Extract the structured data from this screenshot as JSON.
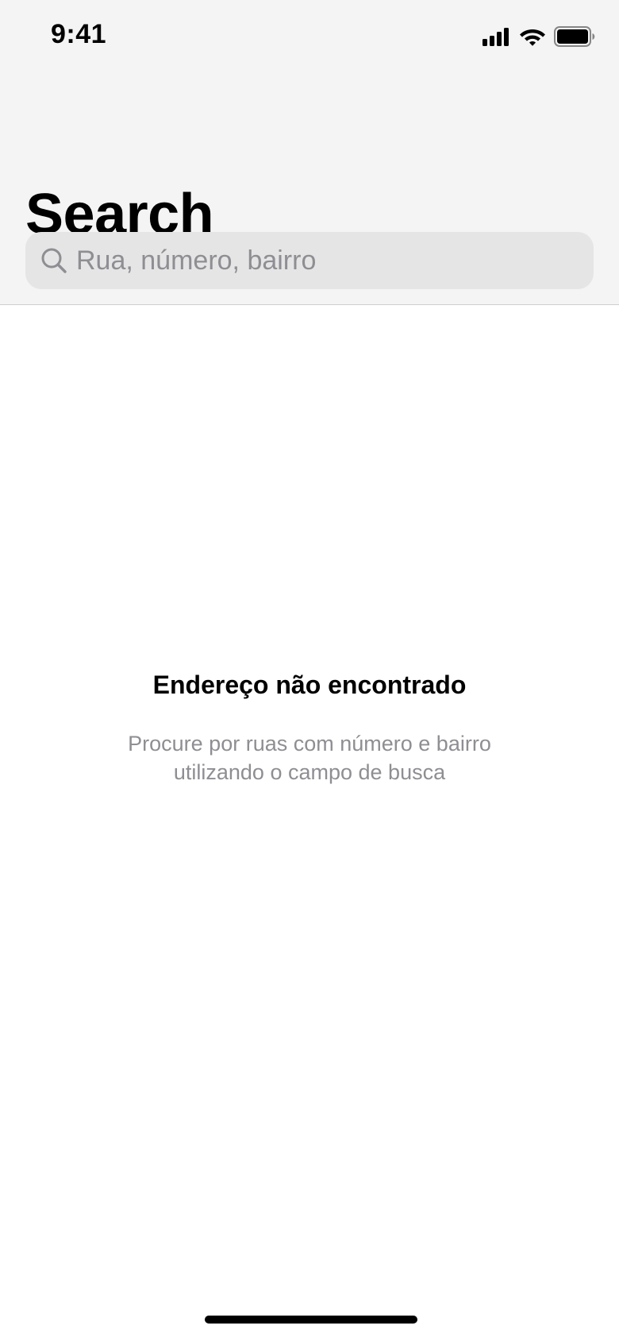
{
  "status_bar": {
    "time": "9:41",
    "icons": [
      "cellular-signal-icon",
      "wifi-icon",
      "battery-icon"
    ]
  },
  "header": {
    "title": "Search"
  },
  "search": {
    "icon": "search-icon",
    "placeholder": "Rua, número, bairro",
    "value": ""
  },
  "empty_state": {
    "title": "Endereço não encontrado",
    "subtitle": "Procure por ruas com número e bairro utilizando o campo de busca"
  },
  "colors": {
    "header_background": "#f4f4f4",
    "search_background": "#e5e5e6",
    "placeholder": "#8e8e93",
    "text_primary": "#000000",
    "background": "#ffffff"
  }
}
